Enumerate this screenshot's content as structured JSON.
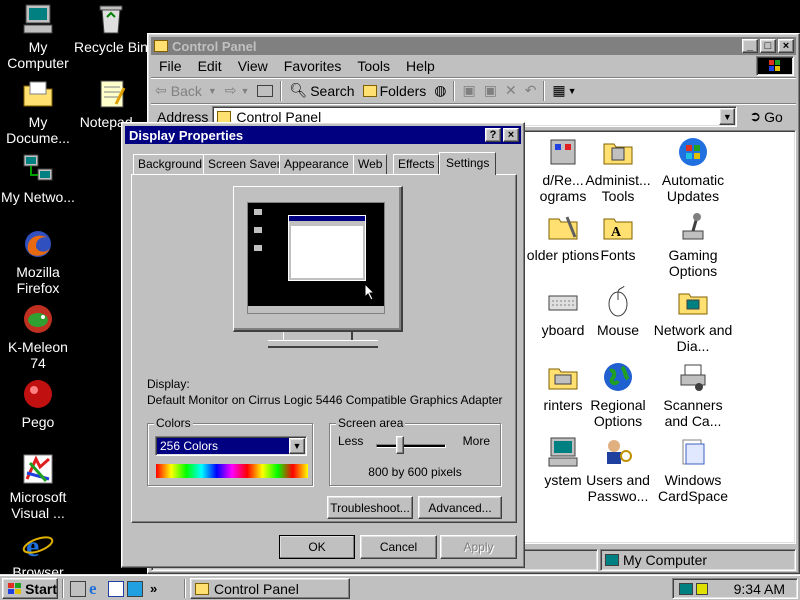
{
  "desktop": {
    "icons": [
      {
        "label": "My Computer"
      },
      {
        "label": "Recycle Bin"
      },
      {
        "label": "My Docume..."
      },
      {
        "label": "Notepad..."
      },
      {
        "label": "My Netwo..."
      },
      {
        "label": "Mozilla Firefox"
      },
      {
        "label": "K-Meleon 74"
      },
      {
        "label": "Pego"
      },
      {
        "label": "Microsoft Visual ..."
      },
      {
        "label": "Browser"
      }
    ]
  },
  "control_panel": {
    "title": "Control Panel",
    "menu": [
      "File",
      "Edit",
      "View",
      "Favorites",
      "Tools",
      "Help"
    ],
    "toolbar": {
      "back": "Back",
      "search": "Search",
      "folders": "Folders"
    },
    "address_label": "Address",
    "address_value": "Control Panel",
    "go_label": "Go",
    "items": [
      {
        "label": "d/Re... ograms"
      },
      {
        "label": "Administ... Tools"
      },
      {
        "label": "Automatic Updates"
      },
      {
        "label": "older ptions"
      },
      {
        "label": "Fonts"
      },
      {
        "label": "Gaming Options"
      },
      {
        "label": "yboard"
      },
      {
        "label": "Mouse"
      },
      {
        "label": "Network and Dia..."
      },
      {
        "label": "rinters"
      },
      {
        "label": "Regional Options"
      },
      {
        "label": "Scanners and Ca..."
      },
      {
        "label": "ystem"
      },
      {
        "label": "Users and Passwo..."
      },
      {
        "label": "Windows CardSpace"
      }
    ],
    "status_zone": "My Computer"
  },
  "display_properties": {
    "title": "Display Properties",
    "tabs": [
      "Background",
      "Screen Saver",
      "Appearance",
      "Web",
      "Effects",
      "Settings"
    ],
    "active_tab": "Settings",
    "display_label": "Display:",
    "display_value": "Default Monitor on Cirrus Logic 5446 Compatible Graphics Adapter",
    "colors_group": "Colors",
    "colors_value": "256 Colors",
    "screen_area_group": "Screen area",
    "less_label": "Less",
    "more_label": "More",
    "resolution": "800 by 600 pixels",
    "troubleshoot_label": "Troubleshoot...",
    "advanced_label": "Advanced...",
    "ok_label": "OK",
    "cancel_label": "Cancel",
    "apply_label": "Apply",
    "help_button": "?",
    "close_button": "×",
    "slider_position": 0.33
  },
  "taskbar": {
    "start_label": "Start",
    "task_label": "Control Panel",
    "clock": "9:34 AM",
    "quick_launch_arrow": "»"
  },
  "colors": {
    "desktop": "#000000",
    "title_active": "#000080",
    "title_inactive": "#808080",
    "face": "#c0c0c0"
  }
}
